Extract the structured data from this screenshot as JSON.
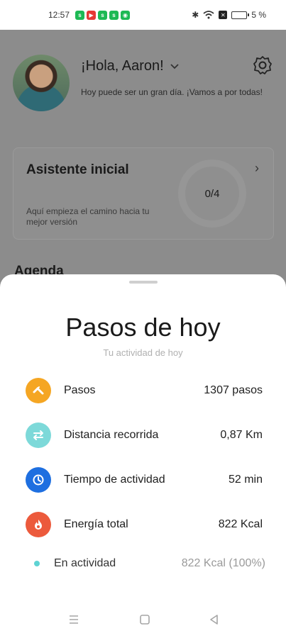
{
  "status_bar": {
    "time": "12:57",
    "battery": "5 %"
  },
  "background": {
    "greeting": "¡Hola, Aaron!",
    "subtitle": "Hoy puede ser un gran día. ¡Vamos a por todas!",
    "card": {
      "title": "Asistente inicial",
      "description": "Aquí empieza el camino hacia tu mejor versión",
      "progress_text": "0/4"
    },
    "agenda_title": "Agenda"
  },
  "sheet": {
    "title": "Pasos de hoy",
    "subtitle": "Tu actividad de hoy",
    "rows": [
      {
        "label": "Pasos",
        "value": "1307 pasos",
        "icon": "shoe-icon",
        "color": "#f5a623"
      },
      {
        "label": "Distancia recorrida",
        "value": "0,87 Km",
        "icon": "arrows-icon",
        "color": "#7dd9d9"
      },
      {
        "label": "Tiempo de actividad",
        "value": "52 min",
        "icon": "clock-icon",
        "color": "#1e6fe0"
      },
      {
        "label": "Energía total",
        "value": "822 Kcal",
        "icon": "flame-icon",
        "color": "#ec5a3c"
      }
    ],
    "sub_row": {
      "label": "En actividad",
      "value": "822 Kcal (100%)",
      "color": "#5ed3d3"
    }
  }
}
